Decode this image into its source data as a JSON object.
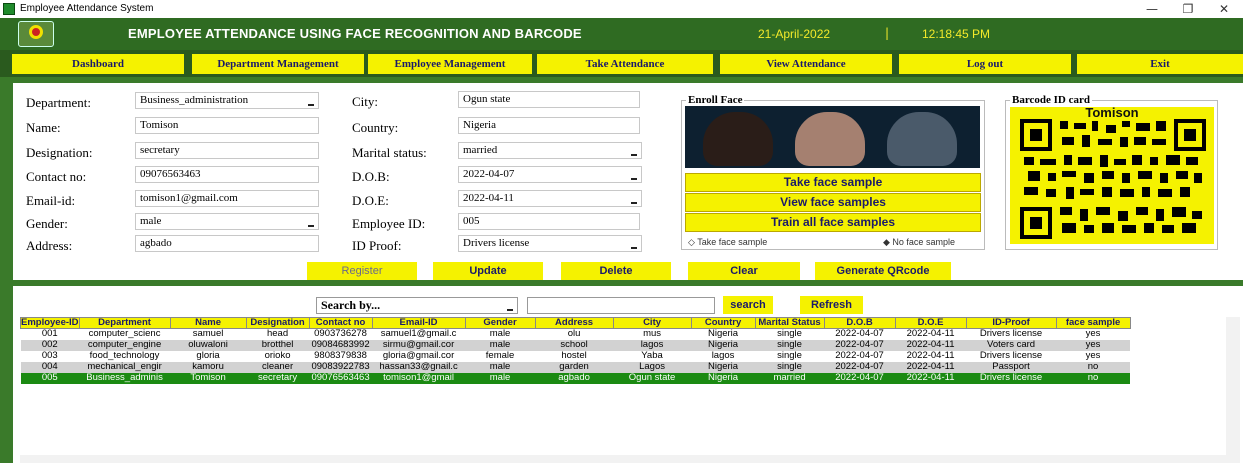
{
  "window": {
    "title": "Employee Attendance System",
    "controls": [
      "—",
      "❐",
      "✕"
    ]
  },
  "header": {
    "heading": "EMPLOYEE ATTENDANCE USING FACE RECOGNITION AND BARCODE",
    "date": "21-April-2022",
    "separator": "|",
    "time": "12:18:45 PM"
  },
  "nav": {
    "items": [
      "Dashboard",
      "Department Management",
      "Employee Management",
      "Take Attendance",
      "View Attendance",
      "Log out",
      "Exit"
    ]
  },
  "form": {
    "department_label": "Department:",
    "department_value": "Business_administration",
    "name_label": "Name:",
    "name_value": "Tomison",
    "designation_label": "Designation:",
    "designation_value": "secretary",
    "contact_label": "Contact no:",
    "contact_value": "09076563463",
    "email_label": "Email-id:",
    "email_value": "tomison1@gmail.com",
    "gender_label": "Gender:",
    "gender_value": "male",
    "address_label": "Address:",
    "address_value": "agbado",
    "city_label": "City:",
    "city_value": "Ogun state",
    "country_label": "Country:",
    "country_value": "Nigeria",
    "marital_label": "Marital status:",
    "marital_value": "married",
    "dob_label": "D.O.B:",
    "dob_value": "2022-04-07",
    "doe_label": "D.O.E:",
    "doe_value": "2022-04-11",
    "empid_label": "Employee ID:",
    "empid_value": "005",
    "idproof_label": "ID Proof:",
    "idproof_value": "Drivers license"
  },
  "enroll": {
    "title": "Enroll Face",
    "take_sample": "Take face sample",
    "view_samples": "View face samples",
    "train_samples": "Train all face samples",
    "radio_take": "Take face sample",
    "radio_none": "No face sample"
  },
  "barcode": {
    "title": "Barcode ID card",
    "name": "Tomison"
  },
  "actions": {
    "register": "Register",
    "update": "Update",
    "delete": "Delete",
    "clear": "Clear",
    "generate_qr": "Generate QRcode"
  },
  "search": {
    "by": "Search by...",
    "search_button": "search",
    "refresh_button": "Refresh"
  },
  "table": {
    "headers": [
      "Employee-ID",
      "Department",
      "Name",
      "Designation",
      "Contact no",
      "Email-ID",
      "Gender",
      "Address",
      "City",
      "Country",
      "Marital Status",
      "D.O.B",
      "D.O.E",
      "ID-Proof",
      "face sample"
    ],
    "rows": [
      [
        "001",
        "computer_scienc",
        "samuel",
        "head",
        "0903736278",
        "samuel1@gmail.c",
        "male",
        "olu",
        "mus",
        "Nigeria",
        "single",
        "2022-04-07",
        "2022-04-11",
        "Drivers license",
        "yes"
      ],
      [
        "002",
        "computer_engine",
        "oluwaloni",
        "brotthel",
        "09084683992",
        "sirmu@gmail.cor",
        "male",
        "school",
        "lagos",
        "Nigeria",
        "single",
        "2022-04-07",
        "2022-04-11",
        "Voters card",
        "yes"
      ],
      [
        "003",
        "food_technology",
        "gloria",
        "orioko",
        "9808379838",
        "gloria@gmail.cor",
        "female",
        "hostel",
        "Yaba",
        "lagos",
        "single",
        "2022-04-07",
        "2022-04-11",
        "Drivers license",
        "yes"
      ],
      [
        "004",
        "mechanical_engir",
        "kamoru",
        "cleaner",
        "09083922783",
        "hassan33@gnail.c",
        "male",
        "garden",
        "Lagos",
        "Nigeria",
        "single",
        "2022-04-07",
        "2022-04-11",
        "Passport",
        "no"
      ],
      [
        "005",
        "Business_adminis",
        "Tomison",
        "secretary",
        "09076563463",
        "tomison1@gmail",
        "male",
        "agbado",
        "Ogun state",
        "Nigeria",
        "married",
        "2022-04-07",
        "2022-04-11",
        "Drivers license",
        "no"
      ]
    ],
    "selected_row": 4
  },
  "colors": {
    "banner": "#2f6b22",
    "button_yellow": "#f5f200",
    "selected_row": "#1b8a12",
    "date_text": "#f4ea2a"
  }
}
